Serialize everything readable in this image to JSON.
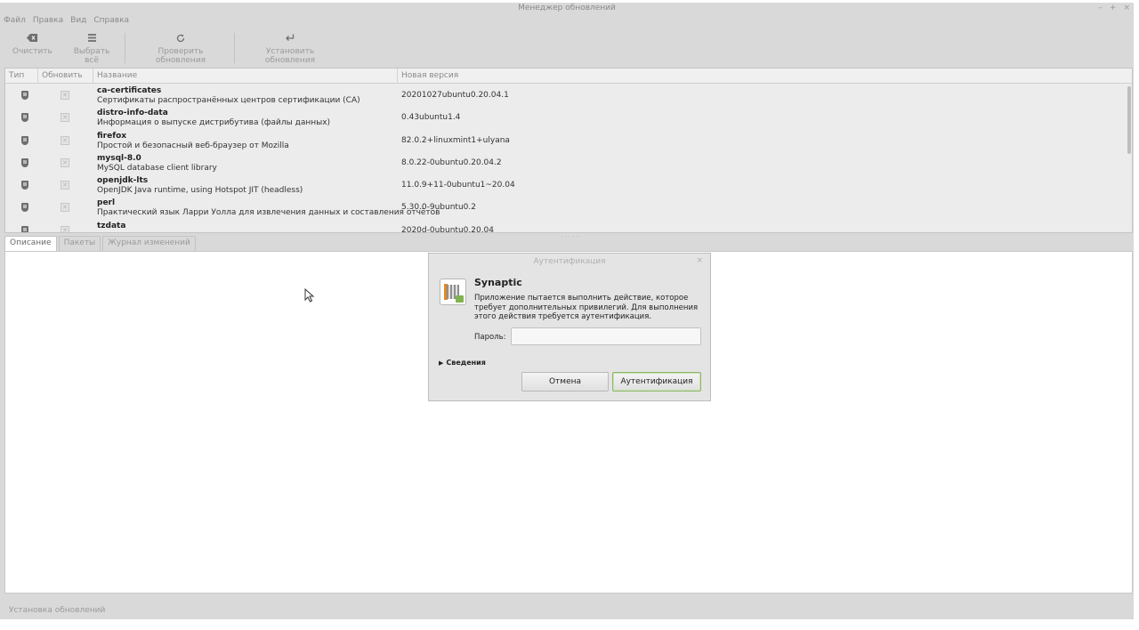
{
  "window": {
    "title": "Менеджер обновлений",
    "controls": [
      "–",
      "+",
      "×"
    ]
  },
  "menu": [
    "Файл",
    "Правка",
    "Вид",
    "Справка"
  ],
  "toolbar": {
    "clear": "Очистить",
    "select_all": "Выбрать всё",
    "check_updates": "Проверить обновления",
    "install_updates": "Установить обновления"
  },
  "table": {
    "columns": {
      "type": "Тип",
      "update": "Обновить",
      "name": "Название",
      "new_version": "Новая версия"
    },
    "rows": [
      {
        "name": "ca-certificates",
        "desc": "Сертификаты распространённых центров сертификации (CA)",
        "version": "20201027ubuntu0.20.04.1"
      },
      {
        "name": "distro-info-data",
        "desc": "Информация о выпуске дистрибутива (файлы данных)",
        "version": "0.43ubuntu1.4"
      },
      {
        "name": "firefox",
        "desc": "Простой и безопасный веб-браузер от Mozilla",
        "version": "82.0.2+linuxmint1+ulyana"
      },
      {
        "name": "mysql-8.0",
        "desc": "MySQL database client library",
        "version": "8.0.22-0ubuntu0.20.04.2"
      },
      {
        "name": "openjdk-lts",
        "desc": "OpenJDK Java runtime, using Hotspot JIT (headless)",
        "version": "11.0.9+11-0ubuntu1~20.04"
      },
      {
        "name": "perl",
        "desc": "Практический язык Ларри Уолла для извлечения данных и составления отчётов",
        "version": "5.30.0-9ubuntu0.2"
      },
      {
        "name": "tzdata",
        "desc": "",
        "version": "2020d-0ubuntu0.20.04"
      }
    ]
  },
  "tabs": [
    "Описание",
    "Пакеты",
    "Журнал изменений"
  ],
  "status": "Установка обновлений",
  "dialog": {
    "title": "Аутентификация",
    "close": "×",
    "heading": "Synaptic",
    "message": "Приложение пытается выполнить действие, которое требует дополнительных привилегий. Для выполнения этого действия требуется аутентификация.",
    "password_label": "Пароль:",
    "password_value": "",
    "details": "Сведения",
    "cancel": "Отмена",
    "authenticate": "Аутентификация"
  },
  "icons": {
    "clear": "eraser-icon",
    "select_all": "select-all-icon",
    "check_updates": "refresh-icon",
    "install_updates": "install-icon",
    "row_type": "shield-icon",
    "dialog_app": "synaptic-icon"
  },
  "colors": {
    "window_bg": "#d9d9d9",
    "accent_green": "#8fb86a"
  }
}
